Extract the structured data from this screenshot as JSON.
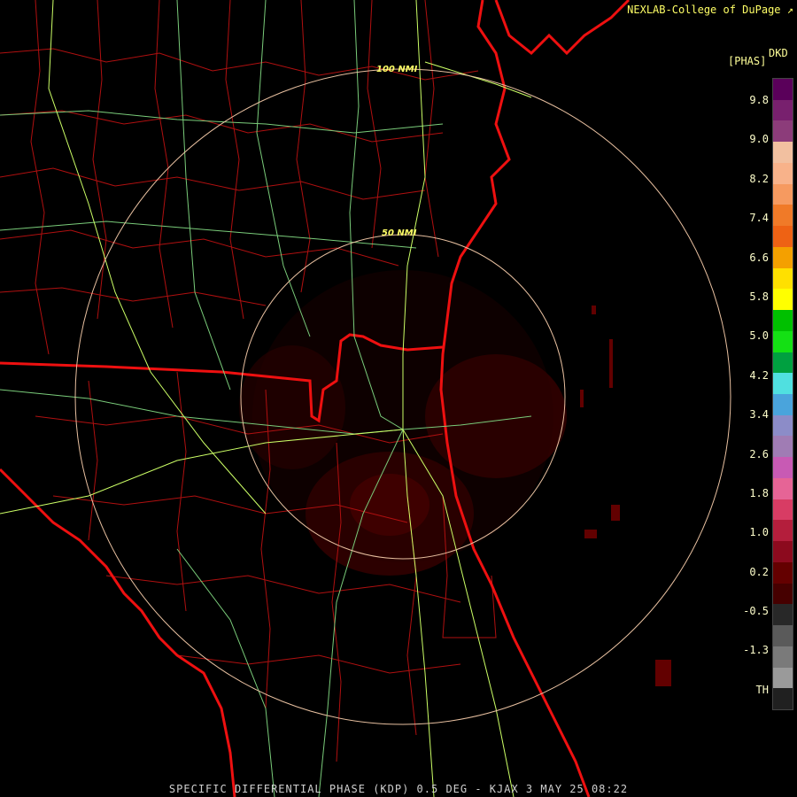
{
  "header": {
    "credit": "NEXLAB-College of DuPage",
    "credit_icon": "nexlab-logo-icon",
    "product": "DKD",
    "units": "[PHAS]"
  },
  "rings": [
    {
      "label": "100 NMI"
    },
    {
      "label": "50 NMI"
    }
  ],
  "legend": {
    "ticks": [
      "9.8",
      "9.0",
      "8.2",
      "7.4",
      "6.6",
      "5.8",
      "5.0",
      "4.2",
      "3.4",
      "2.6",
      "1.8",
      "1.0",
      "0.2",
      "-0.5",
      "-1.3",
      "TH"
    ],
    "colors": [
      "#5a005a",
      "#78206e",
      "#8c3c7a",
      "#f2c0a0",
      "#f8b28a",
      "#f69a60",
      "#f07a28",
      "#ee6214",
      "#f4a000",
      "#ffe000",
      "#ffff00",
      "#00c000",
      "#14e014",
      "#00a040",
      "#50e0e0",
      "#4aa4dc",
      "#8c8cc8",
      "#a07cb4",
      "#c85ab4",
      "#e66496",
      "#d83c64",
      "#b41e3c",
      "#8c0a1e",
      "#640000",
      "#460000",
      "#282828",
      "#5a5a5a",
      "#7a7a7a",
      "#9a9a9a",
      "#202020"
    ]
  },
  "footer": {
    "caption": "SPECIFIC DIFFERENTIAL PHASE (KDP) 0.5 DEG - KJAX 3 MAY 25 08:22"
  }
}
